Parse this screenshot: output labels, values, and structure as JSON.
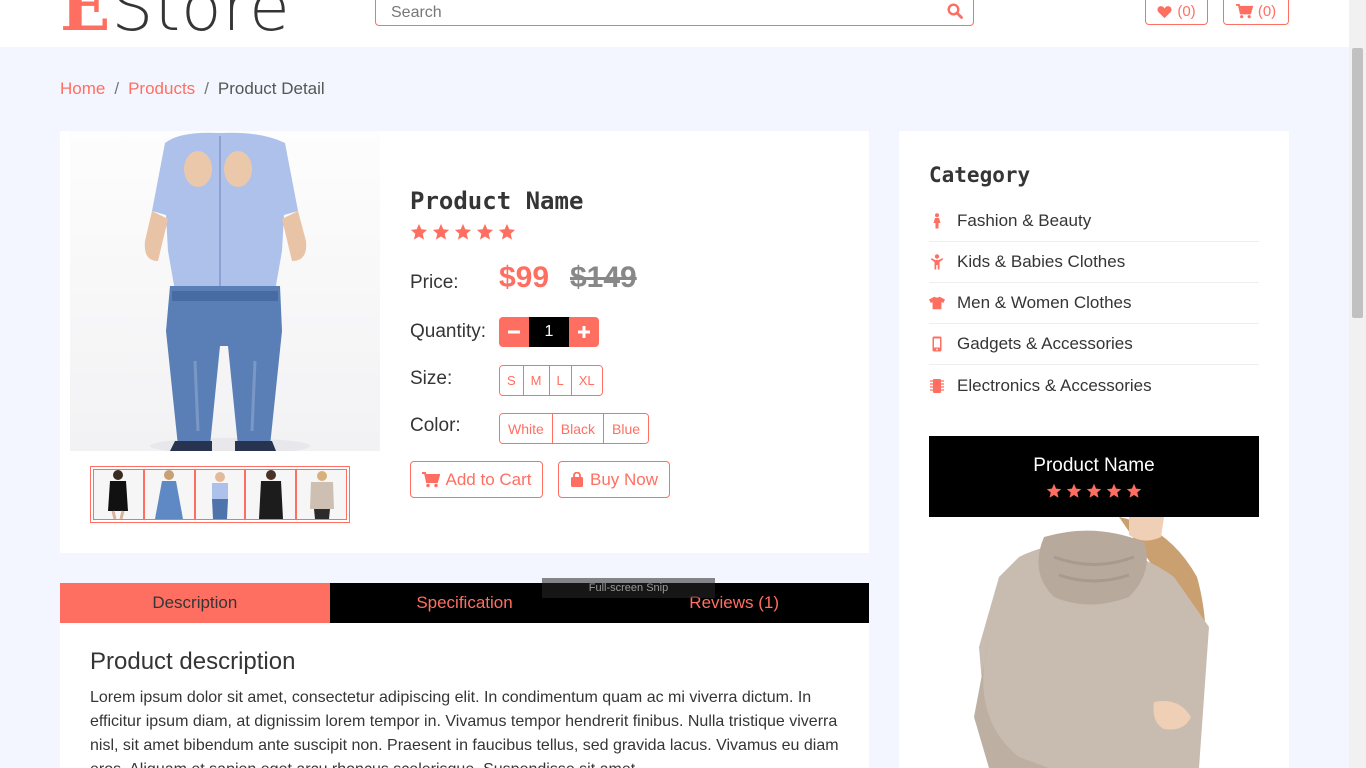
{
  "header": {
    "logo_first": "E",
    "logo_rest": "Store",
    "search_placeholder": "Search",
    "wishlist_count": "(0)",
    "cart_count": "(0)"
  },
  "breadcrumb": {
    "home": "Home",
    "products": "Products",
    "current": "Product Detail",
    "separator": "/"
  },
  "product": {
    "name": "Product Name",
    "rating": 5,
    "price_label": "Price:",
    "price_new": "$99",
    "price_old": "$149",
    "quantity_label": "Quantity:",
    "quantity_value": "1",
    "size_label": "Size:",
    "sizes": [
      "S",
      "M",
      "L",
      "XL"
    ],
    "color_label": "Color:",
    "colors": [
      "White",
      "Black",
      "Blue"
    ],
    "add_to_cart": "Add to Cart",
    "buy_now": "Buy Now"
  },
  "tabs": [
    "Description",
    "Specification",
    "Reviews (1)"
  ],
  "snip_overlay": "Full-screen Snip",
  "description": {
    "title": "Product description",
    "text": "Lorem ipsum dolor sit amet, consectetur adipiscing elit. In condimentum quam ac mi viverra dictum. In efficitur ipsum diam, at dignissim lorem tempor in. Vivamus tempor hendrerit finibus. Nulla tristique viverra nisl, sit amet bibendum ante suscipit non. Praesent in faucibus tellus, sed gravida lacus. Vivamus eu diam eros. Aliquam et sapien eget arcu rhoncus scelerisque. Suspendisse sit amet"
  },
  "sidebar": {
    "category_title": "Category",
    "categories": [
      {
        "label": "Fashion & Beauty",
        "icon": "female-icon"
      },
      {
        "label": "Kids & Babies Clothes",
        "icon": "child-icon"
      },
      {
        "label": "Men & Women Clothes",
        "icon": "tshirt-icon"
      },
      {
        "label": "Gadgets & Accessories",
        "icon": "mobile-icon"
      },
      {
        "label": "Electronics & Accessories",
        "icon": "microchip-icon"
      }
    ],
    "promo_name": "Product Name",
    "promo_rating": 5
  },
  "colors": {
    "accent": "#FF6F61",
    "dark": "#000000",
    "page_bg": "#f3f6ff",
    "text": "#353535"
  }
}
